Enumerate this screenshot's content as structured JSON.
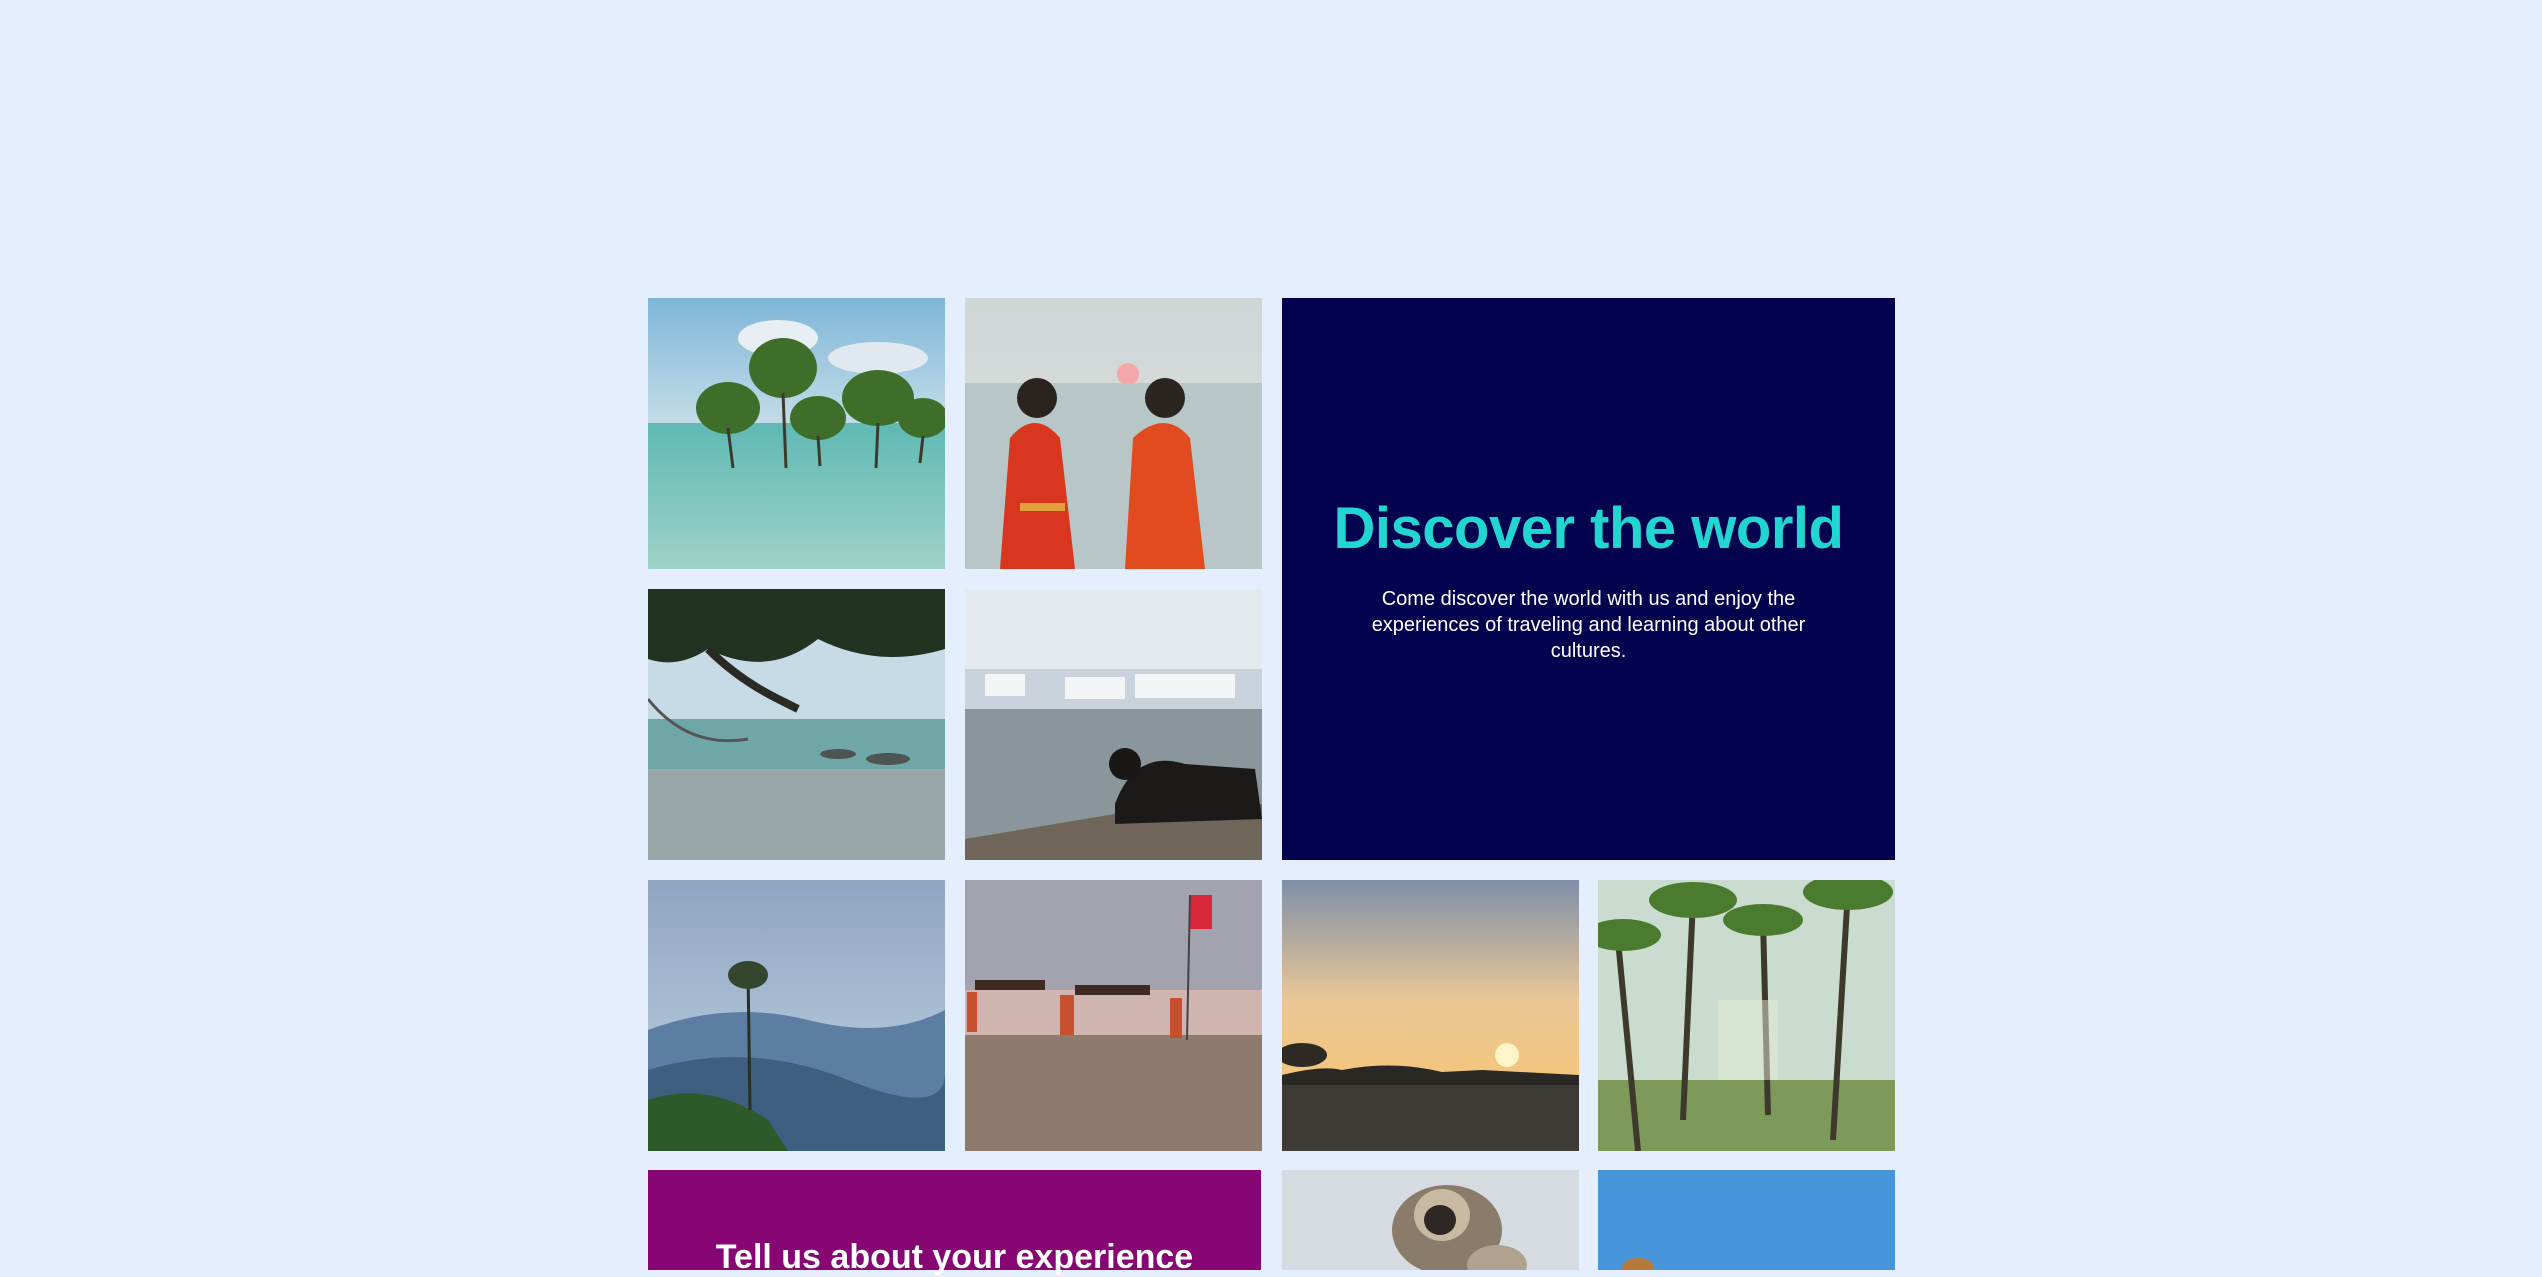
{
  "hero": {
    "title": "Discover the world",
    "description": "Come discover the world with us and enjoy the experiences of traveling and learning about other cultures."
  },
  "promo": {
    "title": "Tell us about your experience"
  },
  "colors": {
    "page_background": "#e4eefe",
    "hero_background": "#02024f",
    "hero_title": "#21d6d1",
    "promo_background": "#870674"
  }
}
